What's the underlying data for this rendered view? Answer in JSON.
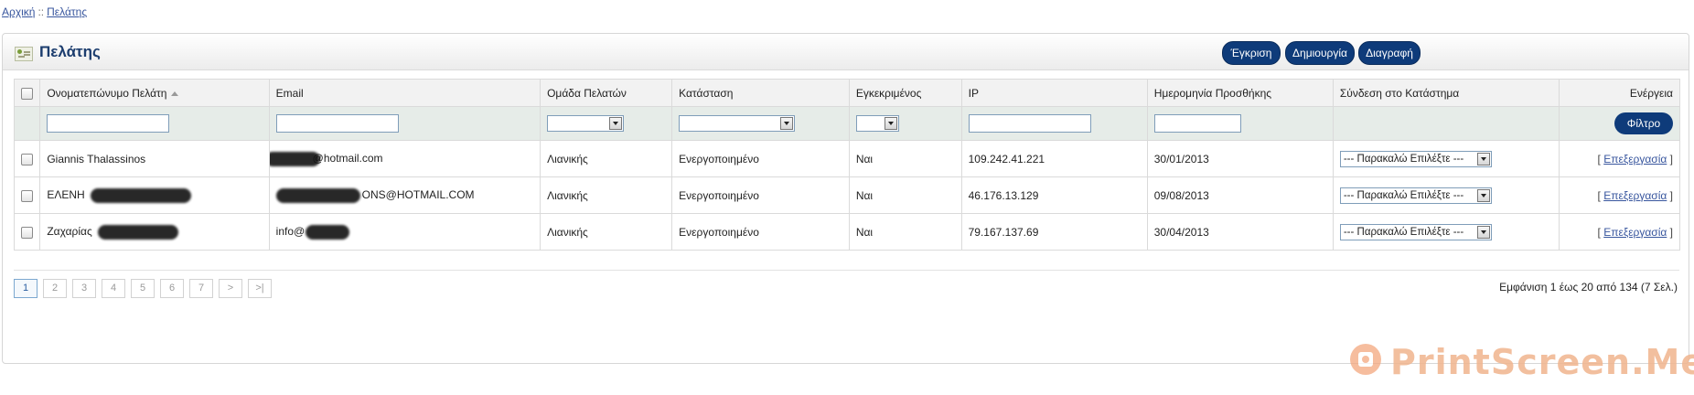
{
  "breadcrumb": {
    "home": "Αρχική",
    "separator": "::",
    "current": "Πελάτης"
  },
  "heading": {
    "icon": "customer-icon",
    "title": "Πελάτης"
  },
  "actions": {
    "approve": "Έγκριση",
    "create": "Δημιουργία",
    "delete": "Διαγραφή"
  },
  "columns": {
    "name": "Ονοματεπώνυμο Πελάτη",
    "email": "Email",
    "group": "Ομάδα Πελατών",
    "status": "Κατάσταση",
    "approved": "Εγκεκριμένος",
    "ip": "IP",
    "date_added": "Ημερομηνία Προσθήκης",
    "login_store": "Σύνδεση στο Κατάστημα",
    "action": "Ενέργεια"
  },
  "filter": {
    "button": "Φίλτρο"
  },
  "rows": [
    {
      "name": "Giannis Thalassinos",
      "email": "@hotmail.com",
      "group": "Λιανικής",
      "status": "Ενεργοποιημένο",
      "approved": "Ναι",
      "ip": "109.242.41.221",
      "date_added": "30/01/2013",
      "store_select": "--- Παρακαλώ Επιλέξτε ---",
      "edit": "Επεξεργασία"
    },
    {
      "name": "ΕΛΕΝΗ",
      "email": "ONS@HOTMAIL.COM",
      "group": "Λιανικής",
      "status": "Ενεργοποιημένο",
      "approved": "Ναι",
      "ip": "46.176.13.129",
      "date_added": "09/08/2013",
      "store_select": "--- Παρακαλώ Επιλέξτε ---",
      "edit": "Επεξεργασία"
    },
    {
      "name": "Ζαχαρίας",
      "email": "info@",
      "group": "Λιανικής",
      "status": "Ενεργοποιημένο",
      "approved": "Ναι",
      "ip": "79.167.137.69",
      "date_added": "30/04/2013",
      "store_select": "--- Παρακαλώ Επιλέξτε ---",
      "edit": "Επεξεργασία"
    }
  ],
  "pagination": {
    "pages": [
      "1",
      "2",
      "3",
      "4",
      "5",
      "6",
      "7"
    ],
    "next": ">",
    "last": ">|",
    "current": "1"
  },
  "summary": "Εμφάνιση 1 έως 20 από 134 (7 Σελ.)",
  "watermark": "PrintScreen.Me"
}
